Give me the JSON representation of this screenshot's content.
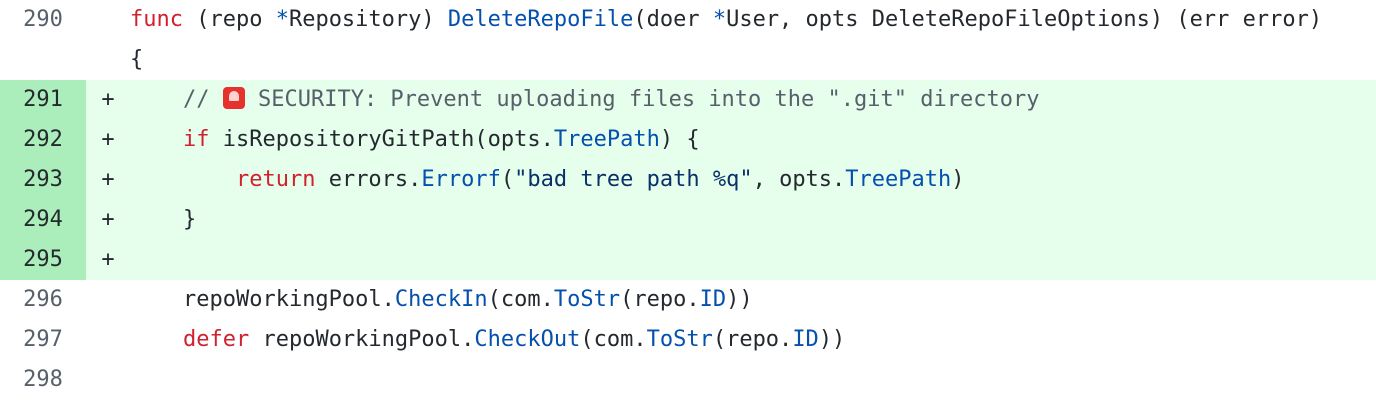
{
  "diff": {
    "lines": [
      {
        "num": "290",
        "marker": "",
        "added": false
      },
      {
        "num": "291",
        "marker": "+",
        "added": true
      },
      {
        "num": "292",
        "marker": "+",
        "added": true
      },
      {
        "num": "293",
        "marker": "+",
        "added": true
      },
      {
        "num": "294",
        "marker": "+",
        "added": true
      },
      {
        "num": "295",
        "marker": "+",
        "added": true
      },
      {
        "num": "296",
        "marker": "",
        "added": false
      },
      {
        "num": "297",
        "marker": "",
        "added": false
      },
      {
        "num": "298",
        "marker": "",
        "added": false
      }
    ],
    "tokens": {
      "l290": {
        "func": "func",
        "a": " (repo ",
        "star1": "*",
        "b": "Repository) ",
        "fname": "DeleteRepoFile",
        "c": "(doer ",
        "star2": "*",
        "d": "User, opts DeleteRepoFileOptions) (err error) {"
      },
      "l291": {
        "indent": "    ",
        "a": "// ",
        "icon": "police-car-light-icon",
        "b": " SECURITY: Prevent uploading files into the \".git\" directory"
      },
      "l292": {
        "indent": "    ",
        "kw": "if",
        "a": " isRepositoryGitPath(opts.",
        "field": "TreePath",
        "b": ") {"
      },
      "l293": {
        "indent": "        ",
        "kw": "return",
        "a": " errors.",
        "fn": "Errorf",
        "b": "(",
        "str": "\"bad tree path %q\"",
        "c": ", opts.",
        "field": "TreePath",
        "d": ")"
      },
      "l294": {
        "indent": "    ",
        "a": "}"
      },
      "l295": {
        "a": ""
      },
      "l296": {
        "indent": "    ",
        "a": "repoWorkingPool.",
        "fn1": "CheckIn",
        "b": "(com.",
        "fn2": "ToStr",
        "c": "(repo.",
        "field": "ID",
        "d": "))"
      },
      "l297": {
        "indent": "    ",
        "kw": "defer",
        "a": " repoWorkingPool.",
        "fn1": "CheckOut",
        "b": "(com.",
        "fn2": "ToStr",
        "c": "(repo.",
        "field": "ID",
        "d": "))"
      },
      "l298": {
        "a": ""
      }
    },
    "colors": {
      "added_bg": "#e6ffec",
      "added_gutter_bg": "#aceebb",
      "keyword": "#cf222e",
      "function": "#0550ae",
      "comment": "#57606a",
      "string": "#0a3069"
    }
  }
}
